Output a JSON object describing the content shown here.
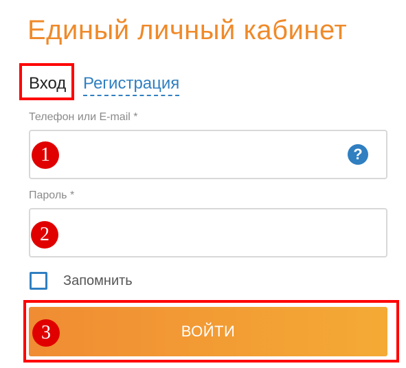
{
  "header": {
    "title": "Единый личный кабинет"
  },
  "tabs": {
    "login_label": "Вход",
    "register_label": "Регистрация"
  },
  "form": {
    "phone_label": "Телефон или E-mail *",
    "phone_value": "",
    "phone_placeholder": "",
    "password_label": "Пароль *",
    "password_value": "",
    "password_placeholder": "",
    "help_symbol": "?",
    "remember_label": "Запомнить",
    "remember_checked": false,
    "submit_label": "ВОЙТИ"
  },
  "annotations": {
    "badge_1": "1",
    "badge_2": "2",
    "badge_3": "3"
  },
  "colors": {
    "accent_orange": "#ef8a2a",
    "link_blue": "#2f7fc1",
    "annotation_red": "#ff0000"
  },
  "icons": {
    "help": "question-circle-icon",
    "checkbox": "checkbox-icon"
  }
}
